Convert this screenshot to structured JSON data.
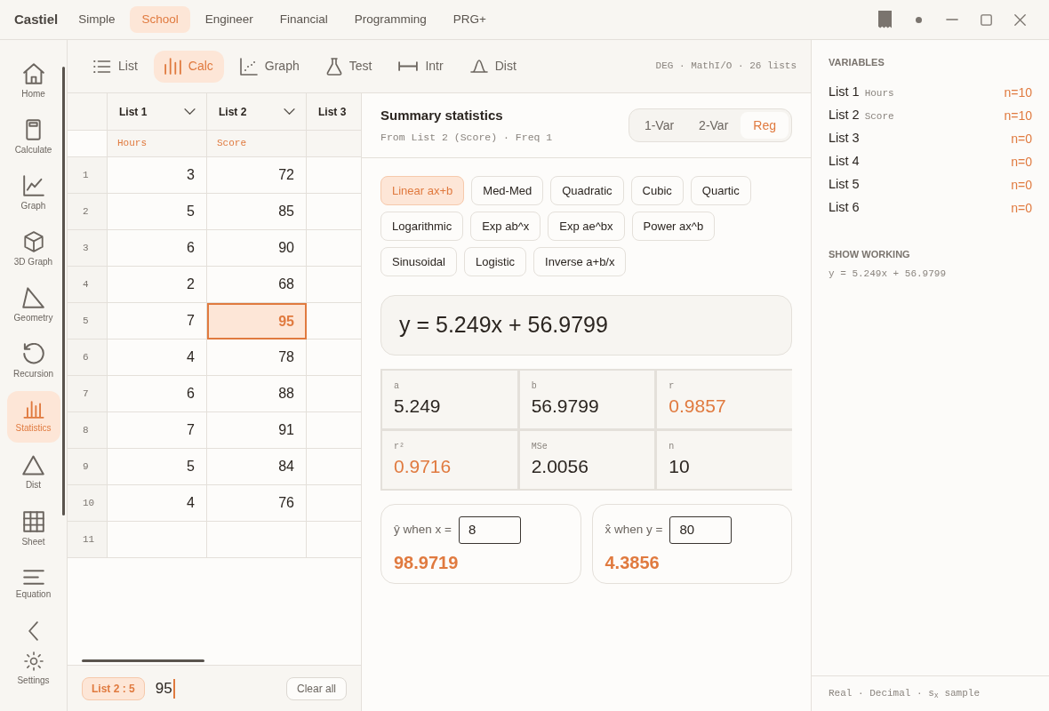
{
  "app": {
    "name": "Castiel"
  },
  "mode_tabs": [
    {
      "label": "Simple",
      "selected": false
    },
    {
      "label": "School",
      "selected": true
    },
    {
      "label": "Engineer",
      "selected": false
    },
    {
      "label": "Financial",
      "selected": false
    },
    {
      "label": "Programming",
      "selected": false
    },
    {
      "label": "PRG+",
      "selected": false
    }
  ],
  "sidebar": {
    "items": [
      {
        "label": "Home",
        "selected": false
      },
      {
        "label": "Calculate",
        "selected": false
      },
      {
        "label": "Graph",
        "selected": false
      },
      {
        "label": "3D Graph",
        "selected": false
      },
      {
        "label": "Geometry",
        "selected": false
      },
      {
        "label": "Recursion",
        "selected": false
      },
      {
        "label": "Statistics",
        "selected": true
      },
      {
        "label": "Dist",
        "selected": false
      },
      {
        "label": "Sheet",
        "selected": false
      },
      {
        "label": "Equation",
        "selected": false
      }
    ],
    "settings": {
      "label": "Settings"
    }
  },
  "toolbar": {
    "tabs": [
      {
        "label": "List",
        "selected": false
      },
      {
        "label": "Calc",
        "selected": true
      },
      {
        "label": "Graph",
        "selected": false
      },
      {
        "label": "Test",
        "selected": false
      },
      {
        "label": "Intr",
        "selected": false
      },
      {
        "label": "Dist",
        "selected": false
      }
    ],
    "status": "DEG · MathI/O · 26 lists"
  },
  "table": {
    "columns": [
      {
        "label": "List 1",
        "name": "Hours",
        "dropdown": true
      },
      {
        "label": "List 2",
        "name": "Score",
        "dropdown": true
      },
      {
        "label": "List 3",
        "dropdown": false
      }
    ],
    "rows": [
      {
        "number": "1",
        "cells": [
          {
            "value": "3",
            "selected": false
          },
          {
            "value": "72",
            "selected": false
          },
          {
            "selected": false
          }
        ]
      },
      {
        "number": "2",
        "cells": [
          {
            "value": "5",
            "selected": false
          },
          {
            "value": "85",
            "selected": false
          },
          {
            "selected": false
          }
        ]
      },
      {
        "number": "3",
        "cells": [
          {
            "value": "6",
            "selected": false
          },
          {
            "value": "90",
            "selected": false
          },
          {
            "selected": false
          }
        ]
      },
      {
        "number": "4",
        "cells": [
          {
            "value": "2",
            "selected": false
          },
          {
            "value": "68",
            "selected": false
          },
          {
            "selected": false
          }
        ]
      },
      {
        "number": "5",
        "cells": [
          {
            "value": "7",
            "selected": false
          },
          {
            "value": "95",
            "selected": true
          },
          {
            "selected": false
          }
        ]
      },
      {
        "number": "6",
        "cells": [
          {
            "value": "4",
            "selected": false
          },
          {
            "value": "78",
            "selected": false
          },
          {
            "selected": false
          }
        ]
      },
      {
        "number": "7",
        "cells": [
          {
            "value": "6",
            "selected": false
          },
          {
            "value": "88",
            "selected": false
          },
          {
            "selected": false
          }
        ]
      },
      {
        "number": "8",
        "cells": [
          {
            "value": "7",
            "selected": false
          },
          {
            "value": "91",
            "selected": false
          },
          {
            "selected": false
          }
        ]
      },
      {
        "number": "9",
        "cells": [
          {
            "value": "5",
            "selected": false
          },
          {
            "value": "84",
            "selected": false
          },
          {
            "selected": false
          }
        ]
      },
      {
        "number": "10",
        "cells": [
          {
            "value": "4",
            "selected": false
          },
          {
            "value": "76",
            "selected": false
          },
          {
            "selected": false
          }
        ]
      },
      {
        "number": "11",
        "cells": [
          {
            "selected": false
          },
          {
            "selected": false
          },
          {
            "selected": false
          }
        ]
      }
    ]
  },
  "entry": {
    "cell": "List 2 : 5",
    "value": "95",
    "clear_button": "Clear all"
  },
  "summary": {
    "title": "Summary statistics",
    "subtitle": "From List 2 (Score) · Freq 1",
    "modes": [
      {
        "label": "1-Var",
        "selected": false
      },
      {
        "label": "2-Var",
        "selected": false
      },
      {
        "label": "Reg",
        "selected": true
      }
    ],
    "model_rows": [
      [
        {
          "label": "Linear ax+b",
          "selected": true
        },
        {
          "label": "Med-Med",
          "selected": false
        },
        {
          "label": "Quadratic",
          "selected": false
        },
        {
          "label": "Cubic",
          "selected": false
        },
        {
          "label": "Quartic",
          "selected": false
        }
      ],
      [
        {
          "label": "Logarithmic",
          "selected": false
        },
        {
          "label": "Exp ab^x",
          "selected": false
        },
        {
          "label": "Exp ae^bx",
          "selected": false
        },
        {
          "label": "Power ax^b",
          "selected": false
        }
      ],
      [
        {
          "label": "Sinusoidal",
          "selected": false
        },
        {
          "label": "Logistic",
          "selected": false
        },
        {
          "label": "Inverse a+b/x",
          "selected": false
        }
      ]
    ],
    "equation": "y = 5.249x + 56.9799",
    "stats": [
      {
        "label": "a",
        "value": "5.249",
        "highlighted": false
      },
      {
        "label": "b",
        "value": "56.9799",
        "highlighted": false
      },
      {
        "label": "r",
        "value": "0.9857",
        "highlighted": true
      },
      {
        "label": "r²",
        "value": "0.9716",
        "highlighted": true
      },
      {
        "label": "MSe",
        "value": "2.0056",
        "highlighted": false
      },
      {
        "label": "n",
        "value": "10",
        "highlighted": false
      }
    ],
    "predictions": [
      {
        "label": "ŷ when x =",
        "input": "8",
        "result": "98.9719"
      },
      {
        "label": "x̂ when y =",
        "input": "80",
        "result": "4.3856"
      }
    ]
  },
  "variables": {
    "title": "VARIABLES",
    "lists": [
      {
        "label": "List 1",
        "name": "Hours",
        "count": "n=10"
      },
      {
        "label": "List 2",
        "name": "Score",
        "count": "n=10"
      },
      {
        "label": "List 3",
        "count": "n=0"
      },
      {
        "label": "List 4",
        "count": "n=0"
      },
      {
        "label": "List 5",
        "count": "n=0"
      },
      {
        "label": "List 6",
        "count": "n=0"
      }
    ]
  },
  "show_working": {
    "title": "SHOW WORKING",
    "lines": [
      "y = 5.249x + 56.9799"
    ]
  },
  "status_bar": {
    "text": "Real · Decimal · s$_{x}$ sample"
  }
}
